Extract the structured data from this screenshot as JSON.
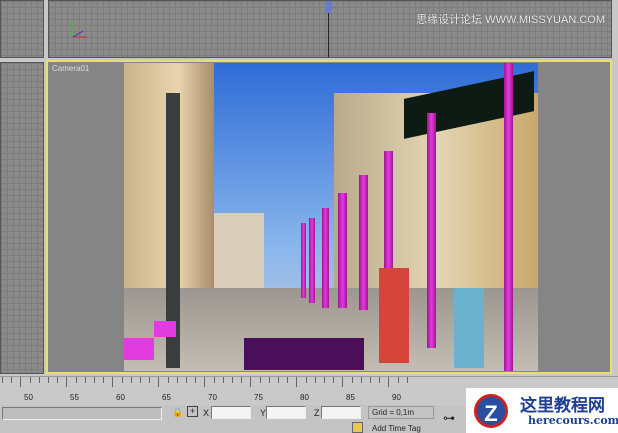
{
  "viewports": {
    "camera_label": "Camera01",
    "watermark": "思缘设计论坛 WWW.MISSYUAN.COM"
  },
  "timeline": {
    "ticks": [
      "50",
      "55",
      "60",
      "65",
      "70",
      "75",
      "80",
      "85",
      "90"
    ]
  },
  "status": {
    "x_label": "X",
    "y_label": "Y",
    "z_label": "Z",
    "x_value": "",
    "y_value": "",
    "z_value": "",
    "grid": "Grid = 0,1m",
    "add_time_tag": "Add Time Tag"
  },
  "logo": {
    "title": "这里教程网",
    "url": "herecours.com"
  },
  "colors": {
    "pillar": "#e23be0",
    "viewport_border": "#e6e070"
  }
}
